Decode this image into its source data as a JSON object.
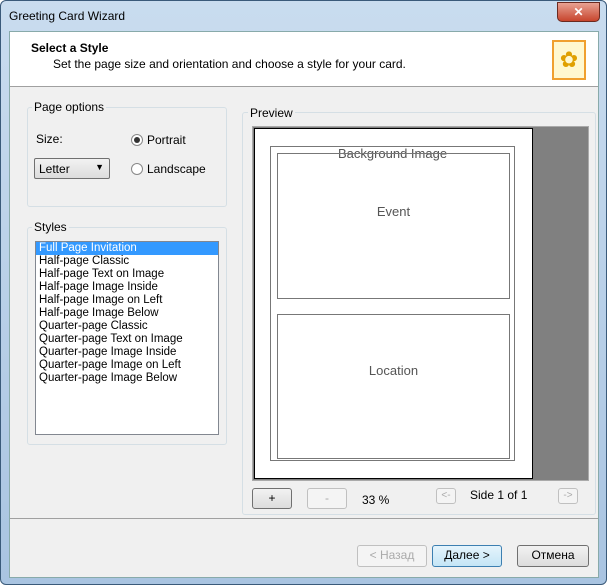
{
  "window": {
    "title": "Greeting Card Wizard",
    "close": "✕"
  },
  "header": {
    "title": "Select a Style",
    "subtitle": "Set the page size and orientation and choose a style for your card."
  },
  "page_options": {
    "legend": "Page options",
    "size_label": "Size:",
    "size_value": "Letter",
    "portrait": "Portrait",
    "landscape": "Landscape"
  },
  "styles": {
    "legend": "Styles",
    "items": [
      "Full Page Invitation",
      "Half-page Classic",
      "Half-page Text on Image",
      "Half-page Image Inside",
      "Half-page Image on Left",
      "Half-page Image Below",
      "Quarter-page Classic",
      "Quarter-page Text on Image",
      "Quarter-page Image Inside",
      "Quarter-page Image on Left",
      "Quarter-page Image Below"
    ]
  },
  "preview": {
    "legend": "Preview",
    "background": "Background Image",
    "event": "Event",
    "location": "Location",
    "zoom_in": "+",
    "zoom_out": "-",
    "zoom": "33 %",
    "prev": "<-",
    "side": "Side 1 of 1",
    "next": "->"
  },
  "buttons": {
    "back": "< Назад",
    "next": "Далее >",
    "cancel": "Отмена"
  }
}
